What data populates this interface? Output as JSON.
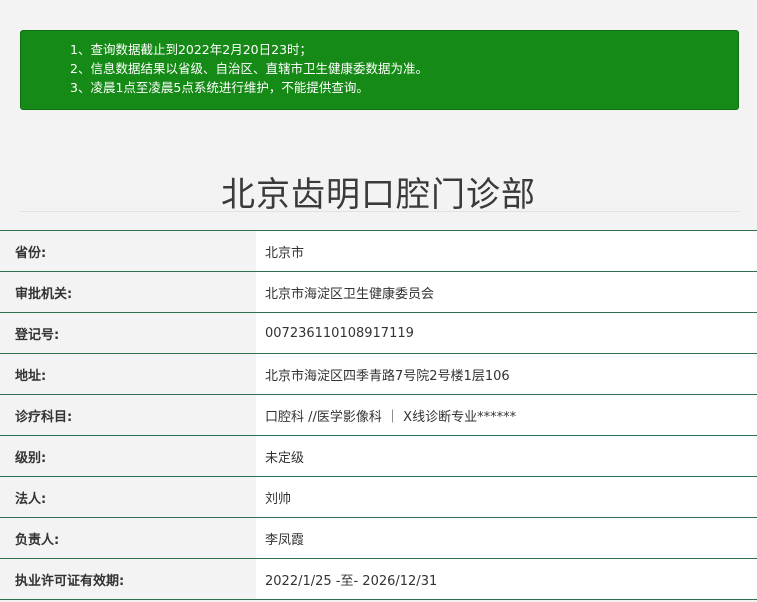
{
  "notice": {
    "lines": [
      "1、查询数据截止到2022年2月20日23时；",
      "2、信息数据结果以省级、自治区、直辖市卫生健康委数据为准。",
      "3、凌晨1点至凌晨5点系统进行维护，不能提供查询。"
    ]
  },
  "page": {
    "title": "北京齿明口腔门诊部"
  },
  "info": {
    "rows": [
      {
        "label": "省份:",
        "value": "北京市"
      },
      {
        "label": "审批机关:",
        "value": "北京市海淀区卫生健康委员会"
      },
      {
        "label": "登记号:",
        "value": "007236110108917119"
      },
      {
        "label": "地址:",
        "value": "北京市海淀区四季青路7号院2号楼1层106"
      },
      {
        "label": "诊疗科目:",
        "value": "口腔科 //医学影像科 ｜ X线诊断专业******"
      },
      {
        "label": "级别:",
        "value": "未定级"
      },
      {
        "label": "法人:",
        "value": "刘帅"
      },
      {
        "label": "负责人:",
        "value": "李凤霞"
      },
      {
        "label": "执业许可证有效期:",
        "value": "2022/1/25 -至- 2026/12/31"
      }
    ]
  },
  "colors": {
    "notice_bg": "#168a16",
    "row_divider": "#2f6f4f"
  }
}
